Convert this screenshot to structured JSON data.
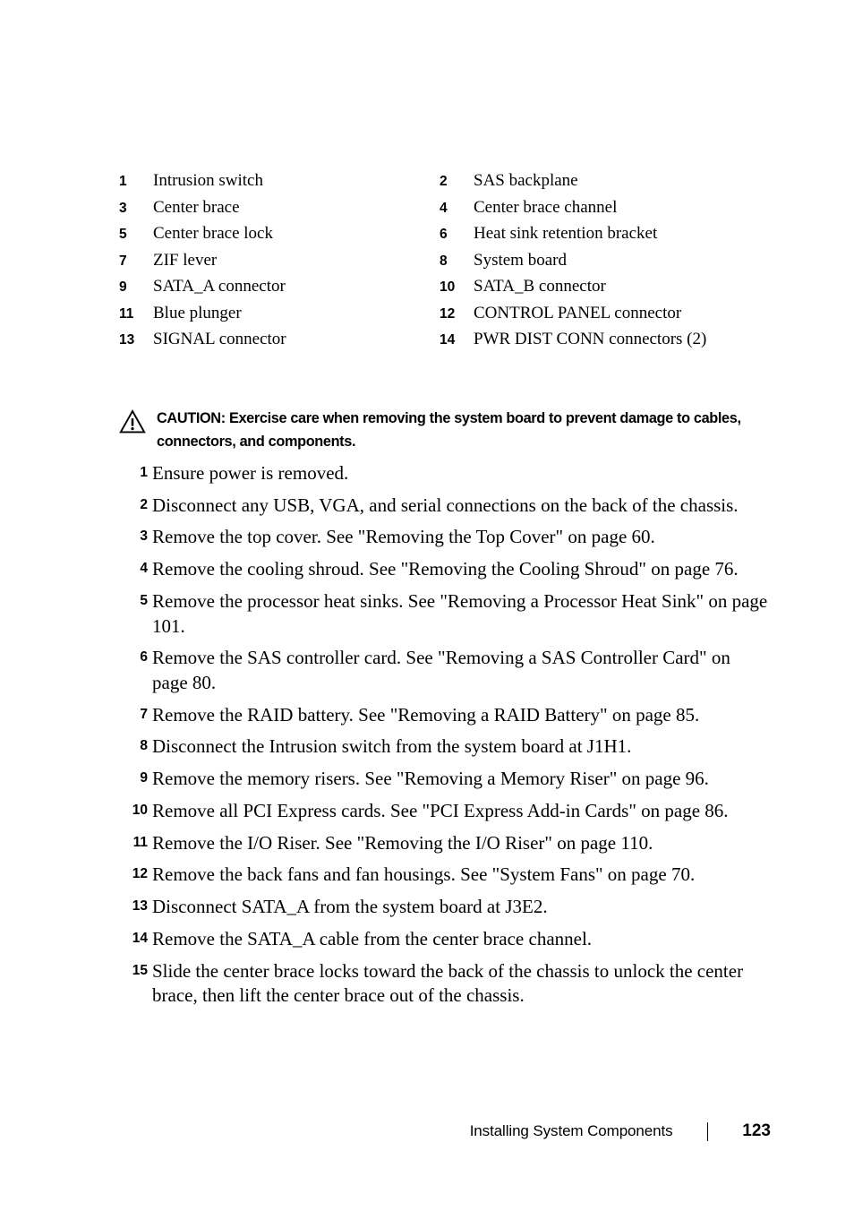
{
  "legend": {
    "rows": [
      {
        "left_num": "1",
        "left_label": "Intrusion switch",
        "right_num": "2",
        "right_label": "SAS backplane"
      },
      {
        "left_num": "3",
        "left_label": "Center brace",
        "right_num": "4",
        "right_label": "Center brace channel"
      },
      {
        "left_num": "5",
        "left_label": "Center brace lock",
        "right_num": "6",
        "right_label": "Heat sink retention bracket"
      },
      {
        "left_num": "7",
        "left_label": "ZIF lever",
        "right_num": "8",
        "right_label": "System board"
      },
      {
        "left_num": "9",
        "left_label": "SATA_A connector",
        "right_num": "10",
        "right_label": "SATA_B connector"
      },
      {
        "left_num": "11",
        "left_label": "Blue plunger",
        "right_num": "12",
        "right_label": "CONTROL PANEL connector"
      },
      {
        "left_num": "13",
        "left_label": "SIGNAL connector",
        "right_num": "14",
        "right_label": "PWR DIST CONN connectors (2)"
      }
    ]
  },
  "caution": {
    "icon": "warning-triangle-icon",
    "label": "CAUTION:",
    "text": " Exercise care when removing the system board to prevent damage to cables, connectors, and components."
  },
  "steps": [
    {
      "num": "1",
      "text": "Ensure power is removed."
    },
    {
      "num": "2",
      "text": "Disconnect any USB, VGA, and serial connections on the back of the chassis."
    },
    {
      "num": "3",
      "text": "Remove the top cover. See \"Removing the Top Cover\" on page 60."
    },
    {
      "num": "4",
      "text": "Remove the cooling shroud. See \"Removing the Cooling Shroud\" on page 76."
    },
    {
      "num": "5",
      "text": "Remove the processor heat sinks. See \"Removing a Processor Heat Sink\" on page 101."
    },
    {
      "num": "6",
      "text": "Remove the SAS controller card. See \"Removing a SAS Controller Card\" on page 80."
    },
    {
      "num": "7",
      "text": "Remove the RAID battery. See \"Removing a RAID Battery\" on page 85."
    },
    {
      "num": "8",
      "text": "Disconnect the Intrusion switch from the system board at J1H1."
    },
    {
      "num": "9",
      "text": "Remove the memory risers. See \"Removing a Memory Riser\" on page 96."
    },
    {
      "num": "10",
      "text": "Remove all PCI Express cards. See \"PCI Express Add-in Cards\" on page 86."
    },
    {
      "num": "11",
      "text": "Remove the I/O Riser. See \"Removing the I/O Riser\" on page 110."
    },
    {
      "num": "12",
      "text": "Remove the back fans and fan housings. See \"System Fans\" on page 70."
    },
    {
      "num": "13",
      "text": "Disconnect SATA_A from the system board at J3E2."
    },
    {
      "num": "14",
      "text": "Remove the SATA_A cable from the center brace channel."
    },
    {
      "num": "15",
      "text": "Slide the center brace locks toward the back of the chassis to unlock the center brace, then lift the center brace out of the chassis."
    }
  ],
  "footer": {
    "title": "Installing System Components",
    "page": "123"
  }
}
